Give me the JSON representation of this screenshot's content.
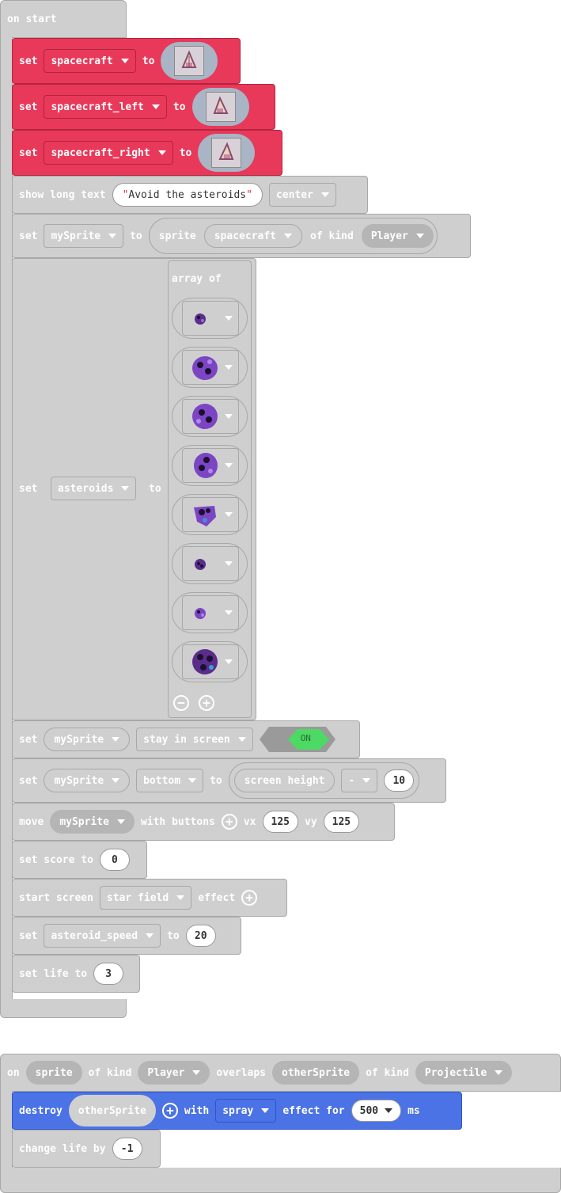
{
  "colors": {
    "gray_block": "#cfcfcf",
    "red_block": "#e8395a",
    "blue_block": "#4b73e6",
    "toggle_on": "#4cd964"
  },
  "on_start": {
    "hat_label": "on start",
    "set1": {
      "kw": "set",
      "var": "spacecraft",
      "to": "to"
    },
    "set2": {
      "kw": "set",
      "var": "spacecraft_left",
      "to": "to"
    },
    "set3": {
      "kw": "set",
      "var": "spacecraft_right",
      "to": "to"
    },
    "show_text": {
      "label": "show long text",
      "text": "Avoid the asteroids",
      "align": "center"
    },
    "set_sprite": {
      "kw": "set",
      "var": "mySprite",
      "to": "to",
      "sprite": "sprite",
      "image": "spacecraft",
      "of_kind": "of kind",
      "kind": "Player"
    },
    "set_asteroids": {
      "kw": "set",
      "var": "asteroids",
      "to": "to",
      "array_label": "array of"
    },
    "stay": {
      "kw": "set",
      "var": "mySprite",
      "prop": "stay in screen",
      "toggle": "ON"
    },
    "bottom": {
      "kw": "set",
      "var": "mySprite",
      "prop": "bottom",
      "to": "to",
      "screen": "screen height",
      "op": "-",
      "value": "10"
    },
    "move": {
      "label": "move",
      "var": "mySprite",
      "with": "with buttons",
      "vx_label": "vx",
      "vx": "125",
      "vy_label": "vy",
      "vy": "125"
    },
    "score": {
      "label": "set score to",
      "value": "0"
    },
    "screen_effect": {
      "label": "start screen",
      "effect": "star field",
      "suffix": "effect"
    },
    "speed": {
      "kw": "set",
      "var": "asteroid_speed",
      "to": "to",
      "value": "20"
    },
    "life": {
      "label": "set life to",
      "value": "3"
    }
  },
  "overlap": {
    "on": "on",
    "sprite": "sprite",
    "of_kind1": "of kind",
    "kind1": "Player",
    "overlaps": "overlaps",
    "other": "otherSprite",
    "of_kind2": "of kind",
    "kind2": "Projectile",
    "destroy": {
      "label": "destroy",
      "var": "otherSprite",
      "with": "with",
      "effect": "spray",
      "effect_for": "effect for",
      "ms_value": "500",
      "ms": "ms"
    },
    "change_life": {
      "label": "change life by",
      "value": "-1"
    }
  }
}
